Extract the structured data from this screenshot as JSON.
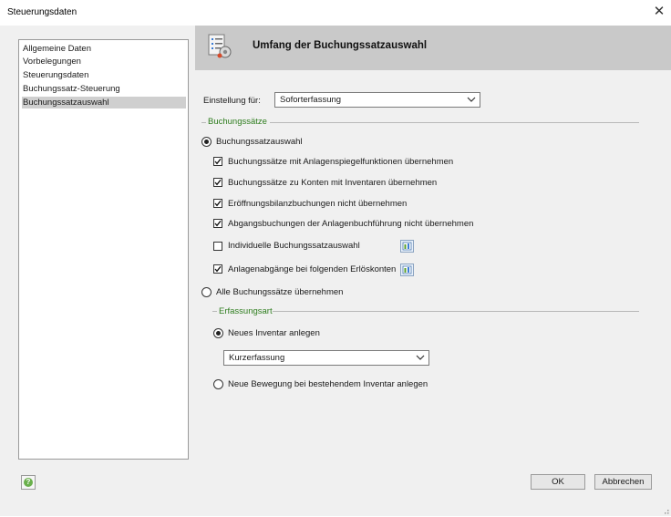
{
  "window": {
    "title": "Steuerungsdaten",
    "close_symbol": "✕"
  },
  "nav": {
    "items": [
      {
        "label": "Allgemeine Daten"
      },
      {
        "label": "Vorbelegungen"
      },
      {
        "label": "Steuerungsdaten"
      },
      {
        "label": "Buchungssatz-Steuerung"
      },
      {
        "label": "Buchungssatzauswahl"
      }
    ],
    "selected": "Buchungssatzauswahl"
  },
  "header": {
    "title": "Umfang der Buchungssatzauswahl"
  },
  "einstellung": {
    "label": "Einstellung für:",
    "value": "Soforterfassung"
  },
  "group_buchungssaetze": {
    "label": "Buchungssätze",
    "radio_auswahl": {
      "label": "Buchungssatzauswahl",
      "selected": true
    },
    "options": [
      {
        "label": "Buchungssätze mit Anlagenspiegelfunktionen übernehmen",
        "checked": true
      },
      {
        "label": "Buchungssätze zu Konten mit Inventaren übernehmen",
        "checked": true
      },
      {
        "label": "Eröffnungsbilanzbuchungen nicht übernehmen",
        "checked": true
      },
      {
        "label": "Abgangsbuchungen der Anlagenbuchführung nicht übernehmen",
        "checked": true
      },
      {
        "label": "Individuelle Buchungssatzauswahl",
        "checked": false
      },
      {
        "label": "Anlagenabgänge bei folgenden Erlöskonten",
        "checked": true
      }
    ],
    "radio_alle": {
      "label": "Alle Buchungssätze übernehmen",
      "selected": false
    }
  },
  "group_erfassungsart": {
    "label": "Erfassungsart",
    "radio_neu": {
      "label": "Neues Inventar anlegen",
      "selected": true
    },
    "combo_value": "Kurzerfassung",
    "radio_bewegung": {
      "label": "Neue Bewegung bei bestehendem Inventar anlegen",
      "selected": false
    }
  },
  "buttons": {
    "ok": "OK",
    "cancel": "Abbrechen"
  },
  "colors": {
    "group_label": "#2e7d1e",
    "header_bg": "#c9c9c9",
    "selected_nav": "#cfcfcf"
  }
}
